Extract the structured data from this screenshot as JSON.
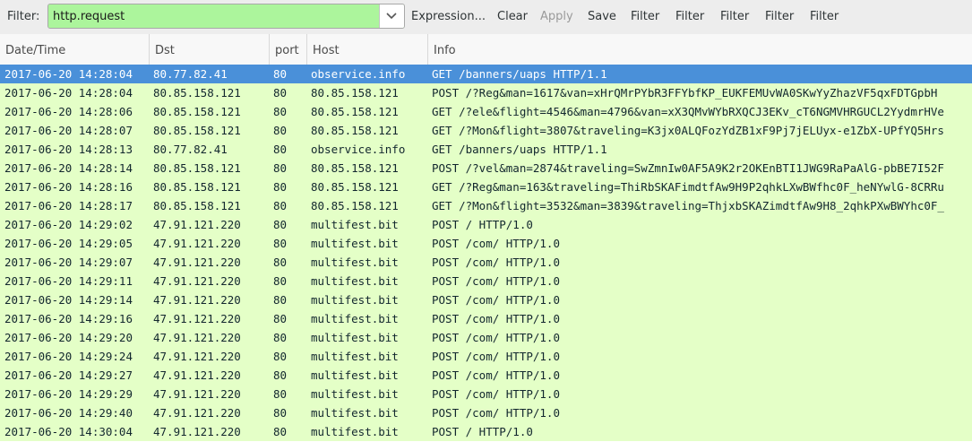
{
  "toolbar": {
    "filter_label": "Filter:",
    "filter_value": "http.request",
    "buttons": [
      "Expression...",
      "Clear",
      "Apply",
      "Save",
      "Filter",
      "Filter",
      "Filter",
      "Filter",
      "Filter"
    ],
    "disabled_button": "Apply"
  },
  "columns": [
    "Date/Time",
    "Dst",
    "port",
    "Host",
    "Info"
  ],
  "colors": {
    "filter_valid_bg": "#acf59c",
    "row_bg": "#e4ffc7",
    "selected_bg": "#4a90d9"
  },
  "rows": [
    {
      "time": "2017-06-20 14:28:04",
      "dst": "80.77.82.41",
      "port": "80",
      "host": "observice.info",
      "info": "GET /banners/uaps HTTP/1.1",
      "selected": true
    },
    {
      "time": "2017-06-20 14:28:04",
      "dst": "80.85.158.121",
      "port": "80",
      "host": "80.85.158.121",
      "info": "POST /?Reg&man=1617&van=xHrQMrPYbR3FFYbfKP_EUKFEMUvWA0SKwYyZhazVF5qxFDTGpbH"
    },
    {
      "time": "2017-06-20 14:28:06",
      "dst": "80.85.158.121",
      "port": "80",
      "host": "80.85.158.121",
      "info": "GET /?ele&flight=4546&man=4796&van=xX3QMvWYbRXQCJ3EKv_cT6NGMVHRGUCL2YydmrHVe"
    },
    {
      "time": "2017-06-20 14:28:07",
      "dst": "80.85.158.121",
      "port": "80",
      "host": "80.85.158.121",
      "info": "GET /?Mon&flight=3807&traveling=K3jx0ALQFozYdZB1xF9Pj7jELUyx-e1ZbX-UPfYQ5Hrs"
    },
    {
      "time": "2017-06-20 14:28:13",
      "dst": "80.77.82.41",
      "port": "80",
      "host": "observice.info",
      "info": "GET /banners/uaps HTTP/1.1"
    },
    {
      "time": "2017-06-20 14:28:14",
      "dst": "80.85.158.121",
      "port": "80",
      "host": "80.85.158.121",
      "info": "POST /?vel&man=2874&traveling=SwZmnIw0AF5A9K2r2OKEnBTI1JWG9RaPaAlG-pbBE7I52F"
    },
    {
      "time": "2017-06-20 14:28:16",
      "dst": "80.85.158.121",
      "port": "80",
      "host": "80.85.158.121",
      "info": "GET /?Reg&man=163&traveling=ThiRbSKAFimdtfAw9H9P2qhkLXwBWfhc0F_heNYwlG-8CRRu"
    },
    {
      "time": "2017-06-20 14:28:17",
      "dst": "80.85.158.121",
      "port": "80",
      "host": "80.85.158.121",
      "info": "GET /?Mon&flight=3532&man=3839&traveling=ThjxbSKAZimdtfAw9H8_2qhkPXwBWYhc0F_"
    },
    {
      "time": "2017-06-20 14:29:02",
      "dst": "47.91.121.220",
      "port": "80",
      "host": "multifest.bit",
      "info": "POST / HTTP/1.0"
    },
    {
      "time": "2017-06-20 14:29:05",
      "dst": "47.91.121.220",
      "port": "80",
      "host": "multifest.bit",
      "info": "POST /com/ HTTP/1.0"
    },
    {
      "time": "2017-06-20 14:29:07",
      "dst": "47.91.121.220",
      "port": "80",
      "host": "multifest.bit",
      "info": "POST /com/ HTTP/1.0"
    },
    {
      "time": "2017-06-20 14:29:11",
      "dst": "47.91.121.220",
      "port": "80",
      "host": "multifest.bit",
      "info": "POST /com/ HTTP/1.0"
    },
    {
      "time": "2017-06-20 14:29:14",
      "dst": "47.91.121.220",
      "port": "80",
      "host": "multifest.bit",
      "info": "POST /com/ HTTP/1.0"
    },
    {
      "time": "2017-06-20 14:29:16",
      "dst": "47.91.121.220",
      "port": "80",
      "host": "multifest.bit",
      "info": "POST /com/ HTTP/1.0"
    },
    {
      "time": "2017-06-20 14:29:20",
      "dst": "47.91.121.220",
      "port": "80",
      "host": "multifest.bit",
      "info": "POST /com/ HTTP/1.0"
    },
    {
      "time": "2017-06-20 14:29:24",
      "dst": "47.91.121.220",
      "port": "80",
      "host": "multifest.bit",
      "info": "POST /com/ HTTP/1.0"
    },
    {
      "time": "2017-06-20 14:29:27",
      "dst": "47.91.121.220",
      "port": "80",
      "host": "multifest.bit",
      "info": "POST /com/ HTTP/1.0"
    },
    {
      "time": "2017-06-20 14:29:29",
      "dst": "47.91.121.220",
      "port": "80",
      "host": "multifest.bit",
      "info": "POST /com/ HTTP/1.0"
    },
    {
      "time": "2017-06-20 14:29:40",
      "dst": "47.91.121.220",
      "port": "80",
      "host": "multifest.bit",
      "info": "POST /com/ HTTP/1.0"
    },
    {
      "time": "2017-06-20 14:30:04",
      "dst": "47.91.121.220",
      "port": "80",
      "host": "multifest.bit",
      "info": "POST / HTTP/1.0"
    }
  ]
}
